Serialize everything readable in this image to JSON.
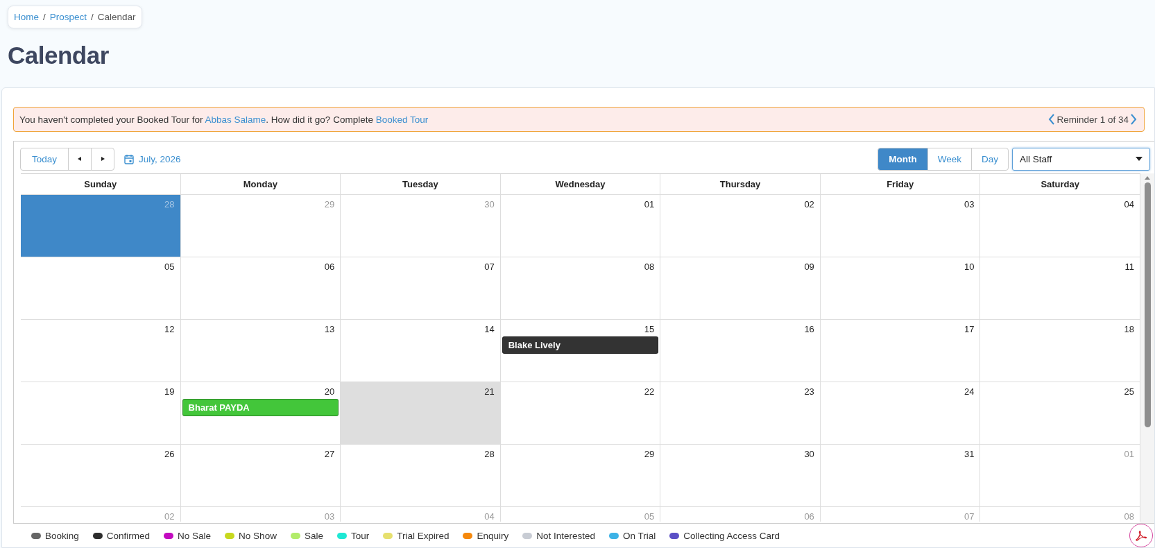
{
  "breadcrumb": [
    {
      "label": "Home",
      "link": true
    },
    {
      "separator": "/",
      "label": "Prospect",
      "link": true
    },
    {
      "separator": "/",
      "label": "Calendar",
      "link": false
    }
  ],
  "page_title": "Calendar",
  "alert": {
    "before": "You haven't completed your Booked Tour for ",
    "person": "Abbas Salame",
    "middle": ". How did it go? Complete ",
    "action": "Booked Tour",
    "reminder": "Reminder 1 of 34"
  },
  "toolbar": {
    "today": "Today",
    "period": "July, 2026",
    "views": [
      {
        "label": "Month",
        "selected": true
      },
      {
        "label": "Week",
        "selected": false
      },
      {
        "label": "Day",
        "selected": false
      }
    ],
    "staff_select": {
      "value": "All Staff"
    }
  },
  "weekdays": [
    "Sunday",
    "Monday",
    "Tuesday",
    "Wednesday",
    "Thursday",
    "Friday",
    "Saturday"
  ],
  "weeks": [
    {
      "days": [
        {
          "date": "28",
          "muted": true,
          "selected": true,
          "today": false
        },
        {
          "date": "29",
          "muted": true,
          "selected": false,
          "today": false
        },
        {
          "date": "30",
          "muted": true,
          "selected": false,
          "today": false
        },
        {
          "date": "01",
          "muted": false,
          "selected": false,
          "today": false
        },
        {
          "date": "02",
          "muted": false,
          "selected": false,
          "today": false
        },
        {
          "date": "03",
          "muted": false,
          "selected": false,
          "today": false
        },
        {
          "date": "04",
          "muted": false,
          "selected": false,
          "today": false
        }
      ]
    },
    {
      "days": [
        {
          "date": "05",
          "muted": false,
          "selected": false,
          "today": false
        },
        {
          "date": "06",
          "muted": false,
          "selected": false,
          "today": false
        },
        {
          "date": "07",
          "muted": false,
          "selected": false,
          "today": false
        },
        {
          "date": "08",
          "muted": false,
          "selected": false,
          "today": false
        },
        {
          "date": "09",
          "muted": false,
          "selected": false,
          "today": false
        },
        {
          "date": "10",
          "muted": false,
          "selected": false,
          "today": false
        },
        {
          "date": "11",
          "muted": false,
          "selected": false,
          "today": false
        }
      ]
    },
    {
      "days": [
        {
          "date": "12",
          "muted": false,
          "selected": false,
          "today": false
        },
        {
          "date": "13",
          "muted": false,
          "selected": false,
          "today": false
        },
        {
          "date": "14",
          "muted": false,
          "selected": false,
          "today": false
        },
        {
          "date": "15",
          "muted": false,
          "selected": false,
          "today": false,
          "events": [
            {
              "label": "Blake Lively",
              "color": "#333333"
            }
          ]
        },
        {
          "date": "16",
          "muted": false,
          "selected": false,
          "today": false
        },
        {
          "date": "17",
          "muted": false,
          "selected": false,
          "today": false
        },
        {
          "date": "18",
          "muted": false,
          "selected": false,
          "today": false
        }
      ]
    },
    {
      "days": [
        {
          "date": "19",
          "muted": false,
          "selected": false,
          "today": false
        },
        {
          "date": "20",
          "muted": false,
          "selected": false,
          "today": false,
          "events": [
            {
              "label": "Bharat PAYDA",
              "color": "#43c63a"
            }
          ]
        },
        {
          "date": "21",
          "muted": false,
          "selected": false,
          "today": true
        },
        {
          "date": "22",
          "muted": false,
          "selected": false,
          "today": false
        },
        {
          "date": "23",
          "muted": false,
          "selected": false,
          "today": false
        },
        {
          "date": "24",
          "muted": false,
          "selected": false,
          "today": false
        },
        {
          "date": "25",
          "muted": false,
          "selected": false,
          "today": false
        }
      ]
    },
    {
      "days": [
        {
          "date": "26",
          "muted": false,
          "selected": false,
          "today": false
        },
        {
          "date": "27",
          "muted": false,
          "selected": false,
          "today": false
        },
        {
          "date": "28",
          "muted": false,
          "selected": false,
          "today": false
        },
        {
          "date": "29",
          "muted": false,
          "selected": false,
          "today": false
        },
        {
          "date": "30",
          "muted": false,
          "selected": false,
          "today": false
        },
        {
          "date": "31",
          "muted": false,
          "selected": false,
          "today": false
        },
        {
          "date": "01",
          "muted": true,
          "selected": false,
          "today": false
        }
      ]
    },
    {
      "days": [
        {
          "date": "02",
          "muted": true,
          "selected": false,
          "today": false
        },
        {
          "date": "03",
          "muted": true,
          "selected": false,
          "today": false
        },
        {
          "date": "04",
          "muted": true,
          "selected": false,
          "today": false
        },
        {
          "date": "05",
          "muted": true,
          "selected": false,
          "today": false
        },
        {
          "date": "06",
          "muted": true,
          "selected": false,
          "today": false
        },
        {
          "date": "07",
          "muted": true,
          "selected": false,
          "today": false
        },
        {
          "date": "08",
          "muted": true,
          "selected": false,
          "today": false
        }
      ]
    }
  ],
  "legend": [
    {
      "label": "Booking",
      "color": "#666666"
    },
    {
      "label": "Confirmed",
      "color": "#2d2d2d"
    },
    {
      "label": "No Sale",
      "color": "#c30bc0"
    },
    {
      "label": "No Show",
      "color": "#c7d81e"
    },
    {
      "label": "Sale",
      "color": "#b2ec6a"
    },
    {
      "label": "Tour",
      "color": "#1ee8d4"
    },
    {
      "label": "Trial Expired",
      "color": "#e6e06e"
    },
    {
      "label": "Enquiry",
      "color": "#f5880c"
    },
    {
      "label": "Not Interested",
      "color": "#c8ccd4"
    },
    {
      "label": "On Trial",
      "color": "#3cb2e6"
    },
    {
      "label": "Collecting Access Card",
      "color": "#5a4fc6"
    }
  ]
}
